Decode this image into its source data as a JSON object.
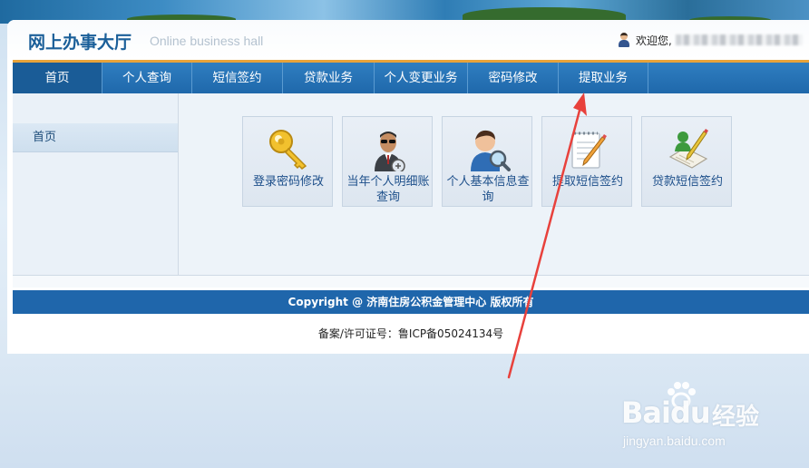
{
  "header": {
    "title": "网上办事大厅",
    "subtitle": "Online business hall",
    "welcome": "欢迎您,"
  },
  "nav": {
    "items": [
      {
        "label": "首页"
      },
      {
        "label": "个人查询"
      },
      {
        "label": "短信签约"
      },
      {
        "label": "贷款业务"
      },
      {
        "label": "个人变更业务"
      },
      {
        "label": "密码修改"
      },
      {
        "label": "提取业务"
      }
    ],
    "active_index": 0
  },
  "sidebar": {
    "items": [
      {
        "label": "首页"
      }
    ]
  },
  "tiles": [
    {
      "label": "登录密码修改",
      "icon": "key-icon"
    },
    {
      "label": "当年个人明细账查询",
      "icon": "officer-icon"
    },
    {
      "label": "个人基本信息查询",
      "icon": "user-search-icon"
    },
    {
      "label": "提取短信签约",
      "icon": "notepad-pen-icon"
    },
    {
      "label": "贷款短信签约",
      "icon": "sign-document-icon"
    }
  ],
  "footer": {
    "copyright": "Copyright @ 济南住房公积金管理中心 版权所有",
    "icp": "备案/许可证号：鲁ICP备05024134号"
  },
  "watermark": {
    "brand": "Baidu",
    "cn": "经验",
    "url": "jingyan.baidu.com"
  },
  "colors": {
    "nav_blue": "#1f68ab",
    "nav_accent": "#e8a33a",
    "title_blue": "#1b5f99",
    "annotation_red": "#e8413c"
  }
}
